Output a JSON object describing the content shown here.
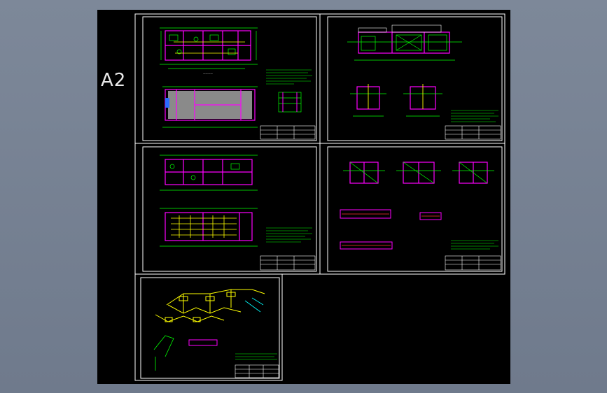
{
  "sheet": {
    "label": "A2",
    "size_name": "A2"
  },
  "colors": {
    "background": "#7a8596",
    "canvas": "#000000",
    "frame": "#ffffff",
    "wall": "#ff00ff",
    "annotation": "#00ff00",
    "pipe": "#ffff00",
    "grid": "#ff3333",
    "fill": "#8a8a8a",
    "pipework": "#00ffff"
  },
  "drawings": [
    {
      "name": "sheet-1",
      "content": "plans"
    },
    {
      "name": "sheet-2",
      "content": "sections"
    },
    {
      "name": "sheet-3",
      "content": "plans"
    },
    {
      "name": "sheet-4",
      "content": "sections-details"
    },
    {
      "name": "sheet-5",
      "content": "isometric"
    }
  ]
}
